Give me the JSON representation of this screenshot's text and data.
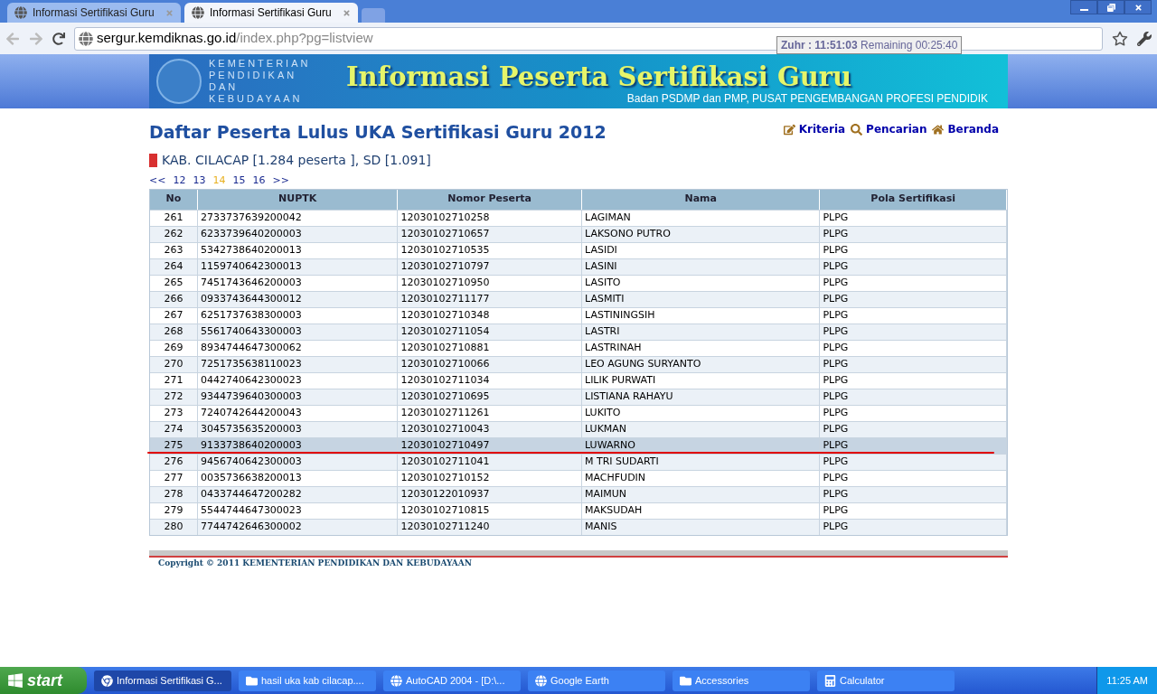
{
  "browser": {
    "tabs": [
      {
        "label": "Informasi Sertifikasi Guru",
        "selected": false
      },
      {
        "label": "Informasi Sertifikasi Guru",
        "selected": true
      }
    ],
    "url_host": "sergur.kemdiknas.go.id",
    "url_path": "/index.php?pg=listview",
    "prayer_time": {
      "name": "Zuhr :",
      "time": "11:51:03",
      "remaining": "Remaining 00:25:40"
    }
  },
  "banner": {
    "ministry": [
      "KEMENTERIAN",
      "PENDIDIKAN",
      "DAN",
      "KEBUDAYAAN"
    ],
    "title": "Informasi Peserta Sertifikasi Guru",
    "subtitle": "Badan PSDMP dan PMP, PUSAT PENGEMBANGAN PROFESI PENDIDIK"
  },
  "page": {
    "title": "Daftar Peserta Lulus UKA Sertifikasi Guru 2012",
    "subtitle": "KAB. CILACAP [1.284 peserta ], SD [1.091]",
    "links": [
      {
        "label": "Kriteria",
        "kind": "edit"
      },
      {
        "label": "Pencarian",
        "kind": "search"
      },
      {
        "label": "Beranda",
        "kind": "home"
      }
    ],
    "pagination": [
      {
        "label": "<<",
        "selected": false
      },
      {
        "label": "12",
        "selected": false
      },
      {
        "label": "13",
        "selected": false
      },
      {
        "label": "14",
        "selected": true
      },
      {
        "label": "15",
        "selected": false
      },
      {
        "label": "16",
        "selected": false
      },
      {
        "label": ">>",
        "selected": false
      }
    ]
  },
  "table": {
    "columns": [
      "No",
      "NUPTK",
      "Nomor Peserta",
      "Nama",
      "Pola Sertifikasi"
    ],
    "rows": [
      {
        "cells": [
          "261",
          "2733737639200042",
          "12030102710258",
          "LAGIMAN",
          "PLPG"
        ],
        "selected": false
      },
      {
        "cells": [
          "262",
          "6233739640200003",
          "12030102710657",
          "LAKSONO PUTRO",
          "PLPG"
        ],
        "selected": false
      },
      {
        "cells": [
          "263",
          "5342738640200013",
          "12030102710535",
          "LASIDI",
          "PLPG"
        ],
        "selected": false
      },
      {
        "cells": [
          "264",
          "1159740642300013",
          "12030102710797",
          "LASINI",
          "PLPG"
        ],
        "selected": false
      },
      {
        "cells": [
          "265",
          "7451743646200003",
          "12030102710950",
          "LASITO",
          "PLPG"
        ],
        "selected": false
      },
      {
        "cells": [
          "266",
          "0933743644300012",
          "12030102711177",
          "LASMITI",
          "PLPG"
        ],
        "selected": false
      },
      {
        "cells": [
          "267",
          "6251737638300003",
          "12030102710348",
          "LASTININGSIH",
          "PLPG"
        ],
        "selected": false
      },
      {
        "cells": [
          "268",
          "5561740643300003",
          "12030102711054",
          "LASTRI",
          "PLPG"
        ],
        "selected": false
      },
      {
        "cells": [
          "269",
          "8934744647300062",
          "12030102710881",
          "LASTRINAH",
          "PLPG"
        ],
        "selected": false
      },
      {
        "cells": [
          "270",
          "7251735638110023",
          "12030102710066",
          "LEO AGUNG SURYANTO",
          "PLPG"
        ],
        "selected": false
      },
      {
        "cells": [
          "271",
          "0442740642300023",
          "12030102711034",
          "LILIK PURWATI",
          "PLPG"
        ],
        "selected": false
      },
      {
        "cells": [
          "272",
          "9344739640300003",
          "12030102710695",
          "LISTIANA RAHAYU",
          "PLPG"
        ],
        "selected": false
      },
      {
        "cells": [
          "273",
          "7240742644200043",
          "12030102711261",
          "LUKITO",
          "PLPG"
        ],
        "selected": false
      },
      {
        "cells": [
          "274",
          "3045735635200003",
          "12030102710043",
          "LUKMAN",
          "PLPG"
        ],
        "selected": false
      },
      {
        "cells": [
          "275",
          "9133738640200003",
          "12030102710497",
          "LUWARNO",
          "PLPG"
        ],
        "selected": true
      },
      {
        "cells": [
          "276",
          "9456740642300003",
          "12030102711041",
          "M TRI SUDARTI",
          "PLPG"
        ],
        "selected": false
      },
      {
        "cells": [
          "277",
          "0035736638200013",
          "12030102710152",
          "MACHFUDIN",
          "PLPG"
        ],
        "selected": false
      },
      {
        "cells": [
          "278",
          "0433744647200282",
          "12030122010937",
          "MAIMUN",
          "PLPG"
        ],
        "selected": false
      },
      {
        "cells": [
          "279",
          "5544744647300023",
          "12030102710815",
          "MAKSUDAH",
          "PLPG"
        ],
        "selected": false
      },
      {
        "cells": [
          "280",
          "7744742646300002",
          "12030102711240",
          "MANIS",
          "PLPG"
        ],
        "selected": false
      }
    ]
  },
  "footer": "Copyright © 2011 KEMENTERIAN PENDIDIKAN DAN KEBUDAYAAN",
  "taskbar": {
    "start": "start",
    "items": [
      {
        "label": "Informasi Sertifikasi G...",
        "selected": true
      },
      {
        "label": "hasil uka kab cilacap....",
        "selected": false
      },
      {
        "label": "AutoCAD 2004 - [D:\\...",
        "selected": false
      },
      {
        "label": "Google Earth",
        "selected": false
      },
      {
        "label": "Accessories",
        "selected": false
      },
      {
        "label": "Calculator",
        "selected": false
      }
    ],
    "clock": "11:25 AM"
  }
}
